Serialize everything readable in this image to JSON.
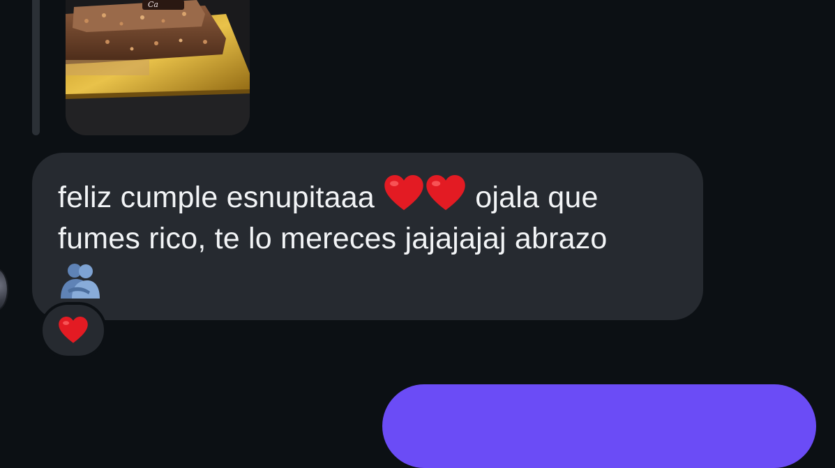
{
  "thread": {
    "replied_image": {
      "icon": "cake-photo",
      "cake_text": "Ca"
    },
    "message": {
      "line1_before": "feliz cumple esnupitaaa",
      "line1_after": "ojala que",
      "line2": "fumes rico, te lo mereces jajajajaj abrazo",
      "emojis": [
        "red-heart",
        "red-heart",
        "people-hugging"
      ]
    },
    "reaction": {
      "icon": "red-heart"
    }
  },
  "colors": {
    "background": "#0c1014",
    "incoming_bubble": "#262a30",
    "outgoing_bubble": "#6b4cf6",
    "text": "#f2f4f6"
  }
}
